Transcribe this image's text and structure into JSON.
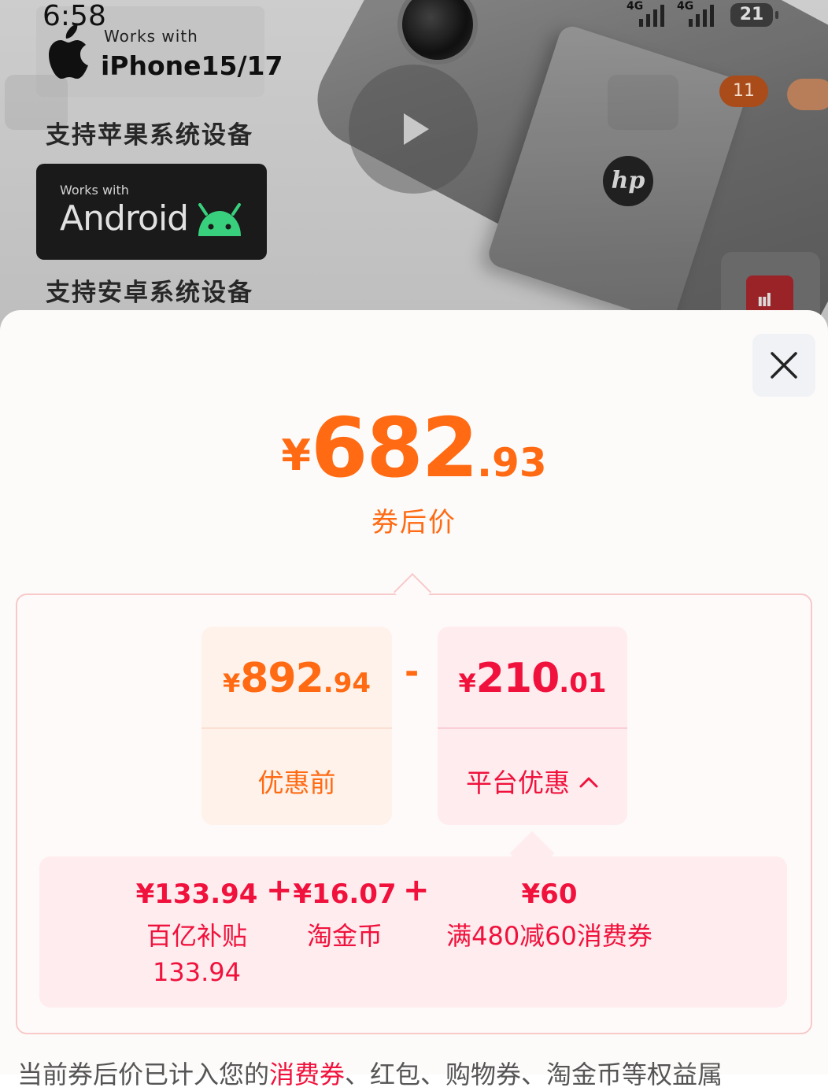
{
  "status_bar": {
    "time": "6:58",
    "network_1": "4G",
    "network_2": "4G",
    "battery": "21"
  },
  "product_image": {
    "apple_badge_works_with": "Works with",
    "apple_badge_device": "iPhone15/17",
    "apple_caption": "支持苹果系统设备",
    "android_badge_works_with": "Works with",
    "android_badge_label": "Android",
    "android_caption": "支持安卓系统设备",
    "brand_logo_text": "hp"
  },
  "floating": {
    "cart_count": "11"
  },
  "sheet": {
    "final_price": {
      "symbol": "¥",
      "integer": "682",
      "decimal": ".93"
    },
    "final_label": "券后价",
    "before": {
      "price": {
        "symbol": "¥",
        "integer": "892",
        "decimal": ".94"
      },
      "label": "优惠前"
    },
    "operator": "-",
    "platform": {
      "price": {
        "symbol": "¥",
        "integer": "210",
        "decimal": ".01"
      },
      "label": "平台优惠"
    },
    "breakdown": [
      {
        "amount": "¥133.94",
        "name_line1": "百亿补贴",
        "name_line2": "133.94"
      },
      {
        "amount": "¥16.07",
        "name_line1": "淘金币",
        "name_line2": ""
      },
      {
        "amount": "¥60",
        "name_line1": "满480减60消费券",
        "name_line2": ""
      }
    ],
    "plus_sign": "+",
    "footer": {
      "prefix": "当前券后价已计入您的",
      "highlight": "消费券",
      "suffix": "、红包、购物券、淘金币等权益属"
    }
  },
  "colors": {
    "accent_orange": "#ff6a13",
    "accent_red": "#f0123c"
  }
}
